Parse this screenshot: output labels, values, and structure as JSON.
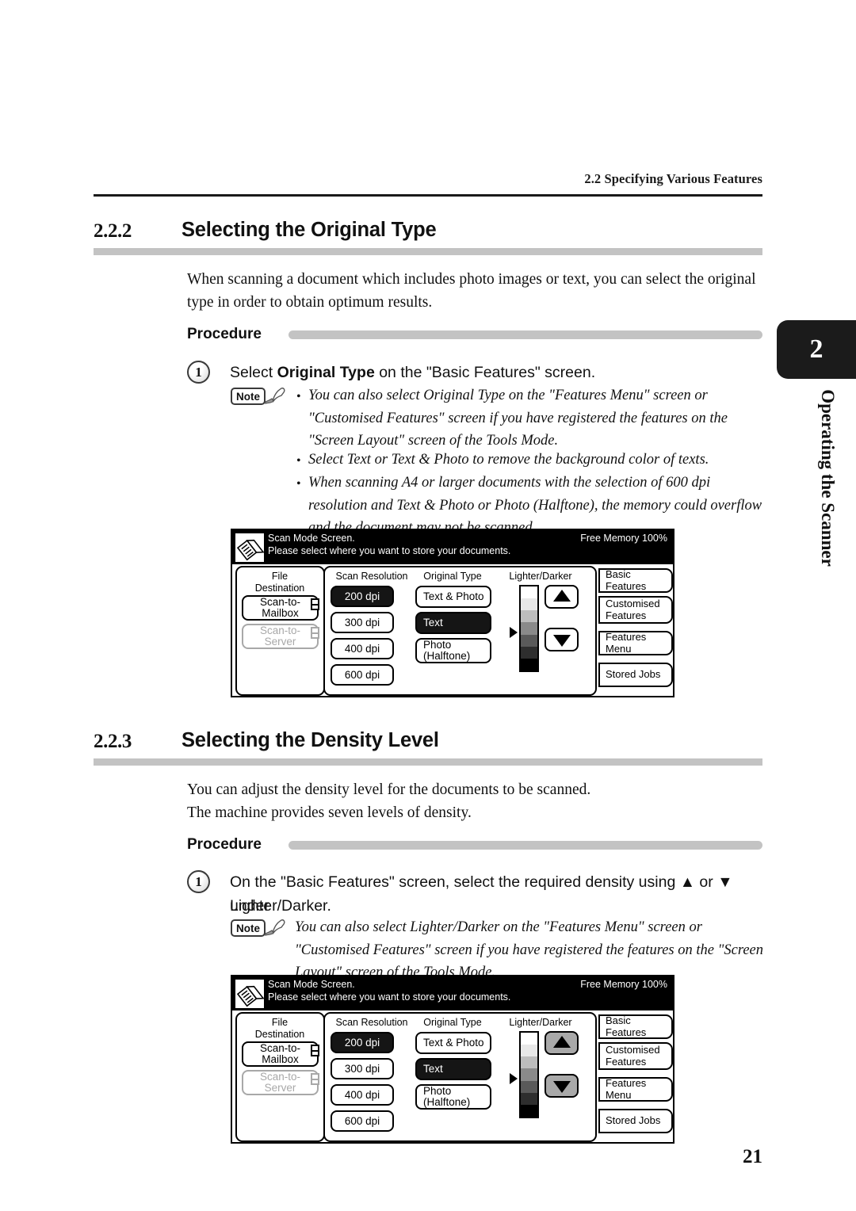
{
  "running_head": "2.2  Specifying Various Features",
  "page_number": "21",
  "side_tab": {
    "chapter_number": "2",
    "chapter_label": "Operating the Scanner"
  },
  "sections": [
    {
      "number": "2.2.2",
      "title": "Selecting the Original Type",
      "intro": "When scanning a document which includes photo images or text, you can select the original type in order to obtain optimum results.",
      "procedure_label": "Procedure",
      "step_number": "1",
      "step_text_before": "Select ",
      "step_text_bold": "Original Type",
      "step_text_after": " on the \"Basic Features\" screen.",
      "note_label": "Note",
      "notes": [
        "You can also select Original Type on the \"Features Menu\" screen or \"Customised Features\" screen if you have registered the features on the \"Screen Layout\" screen of the Tools Mode.",
        "Select Text or Text & Photo to remove the background color of texts.",
        "When scanning A4 or larger documents with the selection of 600 dpi resolution and Text & Photo or Photo (Halftone), the memory could overflow and the document may not be scanned."
      ]
    },
    {
      "number": "2.2.3",
      "title": "Selecting the Density Level",
      "intro_line1": "You can adjust the density level for the documents to be scanned.",
      "intro_line2": "The machine provides seven levels of density.",
      "procedure_label": "Procedure",
      "step_number": "1",
      "step_line1": "On the \"Basic Features\" screen, select the required density using ▲ or ▼ under",
      "step_line2": "Lighter/Darker.",
      "note_label": "Note",
      "notes": [
        "You can also select Lighter/Darker on the \"Features Menu\" screen or \"Customised Features\" screen if you have registered the features on the \"Screen Layout\" screen of the Tools Mode."
      ]
    }
  ],
  "scanner_panel": {
    "header": {
      "line1": "Scan Mode Screen.",
      "line2": "Please select where you want to store your documents.",
      "memory": "Free Memory  100%",
      "icon": "scanner-document-icon"
    },
    "file_destination": {
      "title_line1": "File",
      "title_line2": "Destination",
      "buttons": [
        {
          "line1": "Scan-to-",
          "line2": "Mailbox",
          "state": "selected"
        },
        {
          "line1": "Scan-to-",
          "line2": "Server",
          "state": "disabled"
        }
      ]
    },
    "scan_resolution": {
      "title": "Scan Resolution",
      "options": [
        "200 dpi",
        "300 dpi",
        "400 dpi",
        "600 dpi"
      ],
      "selected": "200 dpi"
    },
    "original_type": {
      "title": "Original Type",
      "options": [
        "Text & Photo",
        "Text",
        "Photo\n(Halftone)"
      ],
      "option_labels": [
        {
          "line1": "Text & Photo",
          "line2": ""
        },
        {
          "line1": "Text",
          "line2": ""
        },
        {
          "line1": "Photo",
          "line2": "(Halftone)"
        }
      ],
      "selected": "Text"
    },
    "lighter_darker": {
      "title": "Lighter/Darker",
      "levels": 7,
      "level_colors": [
        "#ffffff",
        "#e8e8e8",
        "#bdbdbd",
        "#8a8a8a",
        "#5a5a5a",
        "#2e2e2e",
        "#000000"
      ],
      "pointer_level": 4,
      "up_button": "up-arrow",
      "down_button": "down-arrow"
    },
    "feature_tabs": [
      {
        "line1": "Basic Features",
        "line2": ""
      },
      {
        "line1": "Customised",
        "line2": "Features"
      },
      {
        "line1": "Features Menu",
        "line2": ""
      },
      {
        "line1": "Stored Jobs",
        "line2": ""
      }
    ],
    "arrow_highlight": {
      "panel1": false,
      "panel2": true
    }
  },
  "colors": {
    "rule": "#1a1a1a",
    "bar_gray": "#c3c3c3",
    "panel_black": "#000000",
    "disabled_gray": "#a8a8a8",
    "arrow_highlight": "#a9a9a9"
  }
}
